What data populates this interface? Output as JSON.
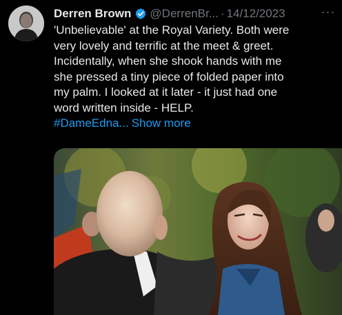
{
  "tweet": {
    "author": {
      "display_name": "Derren Brown",
      "handle": "@DerrenBr...",
      "verified_icon": "verified-badge-icon"
    },
    "separator": "·",
    "date": "14/12/2023",
    "more_icon": "more-options-icon",
    "more_glyph": "···",
    "text_lines": [
      "'Unbelievable' at the Royal Variety. Both were",
      "very lovely and terrific at the meet & greet.",
      "Incidentally, when she shook hands with me",
      "she pressed a tiny piece of folded paper into",
      "my palm. I looked at it later - it just had one",
      "word written inside - HELP."
    ],
    "hashtag": "#DameEdna...",
    "show_more": "Show more",
    "photo_icon": "attached-photo"
  },
  "colors": {
    "background": "#000000",
    "text": "#e7e9ea",
    "muted": "#71767b",
    "link": "#1d9bf0"
  }
}
